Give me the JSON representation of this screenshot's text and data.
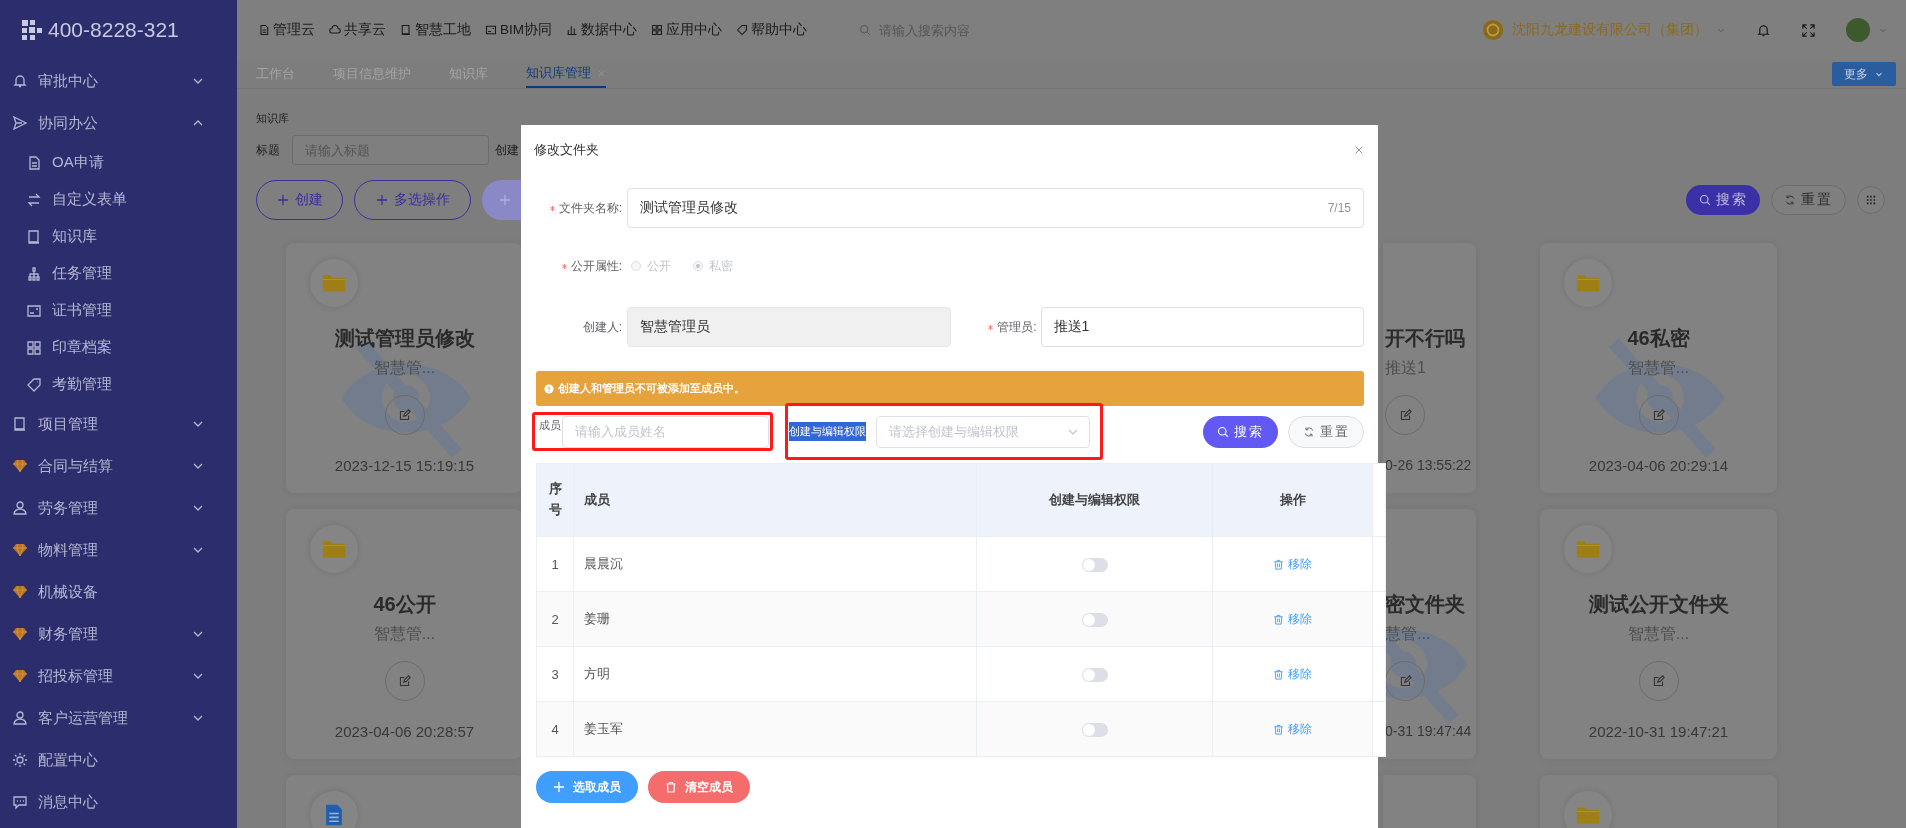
{
  "sidebar": {
    "phone": "400-8228-321",
    "items": [
      {
        "label": "审批中心",
        "expanded": false
      },
      {
        "label": "协同办公",
        "expanded": true,
        "children": [
          {
            "label": "OA申请"
          },
          {
            "label": "自定义表单"
          },
          {
            "label": "知识库"
          },
          {
            "label": "任务管理"
          },
          {
            "label": "证书管理"
          },
          {
            "label": "印章档案"
          },
          {
            "label": "考勤管理"
          }
        ]
      },
      {
        "label": "项目管理",
        "expanded": false
      },
      {
        "label": "合同与结算",
        "expanded": false
      },
      {
        "label": "劳务管理",
        "expanded": false
      },
      {
        "label": "物料管理",
        "expanded": false
      },
      {
        "label": "机械设备"
      },
      {
        "label": "财务管理",
        "expanded": false
      },
      {
        "label": "招投标管理",
        "expanded": false
      },
      {
        "label": "客户运营管理",
        "expanded": false
      },
      {
        "label": "配置中心"
      },
      {
        "label": "消息中心"
      }
    ]
  },
  "top_nav": {
    "items": [
      "管理云",
      "共享云",
      "智慧工地",
      "BIM协同",
      "数据中心",
      "应用中心",
      "帮助中心"
    ],
    "search_placeholder": "请输入搜索内容",
    "company": "沈阳九龙建设有限公司（集团）"
  },
  "tabs": [
    {
      "label": "工作台",
      "selected": false,
      "closable": false
    },
    {
      "label": "项目信息维护",
      "selected": false,
      "closable": false
    },
    {
      "label": "知识库",
      "selected": false,
      "closable": false
    },
    {
      "label": "知识库管理",
      "selected": true,
      "closable": true
    }
  ],
  "more_button": "更多",
  "page": {
    "breadcrumb": "知识库",
    "title_filter": {
      "label": "标题",
      "placeholder": "请输入标题"
    },
    "creator_label": "创建",
    "create_button": "创建",
    "multi_select_button": "多选操作",
    "search_button": "搜索",
    "reset_button": "重置",
    "card_columns": [
      {
        "partial": false,
        "cards": [
          {
            "kind": "folder",
            "title": "测试管理员修改",
            "subtitle": "智慧管...",
            "date": "2023-12-15 15:19:15",
            "private": true
          },
          {
            "kind": "folder",
            "title": "46公开",
            "subtitle": "智慧管...",
            "date": "2023-04-06 20:28:57",
            "private": false
          },
          {
            "kind": "document",
            "private": false
          }
        ]
      },
      {
        "partial": true,
        "cards": [
          {
            "kind": "hidden",
            "title": "开不行吗",
            "subtitle": "推送1",
            "date": "0-26 13:55:22",
            "private": false
          },
          {
            "kind": "hidden",
            "title": "密文件夹",
            "subtitle": "慧管...",
            "date": "0-31 19:47:44",
            "private": true
          },
          {
            "kind": "hidden",
            "private": false
          }
        ]
      },
      {
        "partial": false,
        "cards": [
          {
            "kind": "folder",
            "title": "46私密",
            "subtitle": "智慧管...",
            "date": "2023-04-06 20:29:14",
            "private": true
          },
          {
            "kind": "folder",
            "title": "测试公开文件夹",
            "subtitle": "智慧管...",
            "date": "2022-10-31 19:47:21",
            "private": false
          },
          {
            "kind": "folder",
            "private": false
          }
        ]
      }
    ]
  },
  "dialog": {
    "title": "修改文件夹",
    "name_field": {
      "label": "文件夹名称:",
      "required": true,
      "value": "测试管理员修改",
      "count": "7/15"
    },
    "visibility": {
      "label": "公开属性:",
      "required": true,
      "disabled": true,
      "options": [
        {
          "label": "公开",
          "selected": false
        },
        {
          "label": "私密",
          "selected": true
        }
      ]
    },
    "creator_field": {
      "label": "创建人:",
      "required": false,
      "value": "智慧管理员",
      "disabled": true
    },
    "admin_field": {
      "label": "管理员:",
      "required": true,
      "value": "推送1",
      "disabled": false
    },
    "notice": "创建人和管理员不可被添加至成员中。",
    "member_filter": {
      "label": "成员",
      "placeholder": "请输入成员姓名",
      "highlighted": true
    },
    "permission_filter": {
      "label": "创建与编辑权限",
      "placeholder": "请选择创建与编辑权限",
      "highlighted": true,
      "label_selected": true
    },
    "search_button": "搜索",
    "reset_button": "重置",
    "table": {
      "columns": [
        "序号",
        "成员",
        "创建与编辑权限",
        "操作"
      ],
      "rows": [
        {
          "index": "1",
          "name": "晨晨沉",
          "on": false,
          "action": "移除"
        },
        {
          "index": "2",
          "name": "姜珊",
          "on": false,
          "action": "移除"
        },
        {
          "index": "3",
          "name": "方明",
          "on": false,
          "action": "移除"
        },
        {
          "index": "4",
          "name": "姜玉军",
          "on": false,
          "action": "移除"
        }
      ]
    },
    "add_button": "选取成员",
    "clear_button": "清空成员"
  }
}
